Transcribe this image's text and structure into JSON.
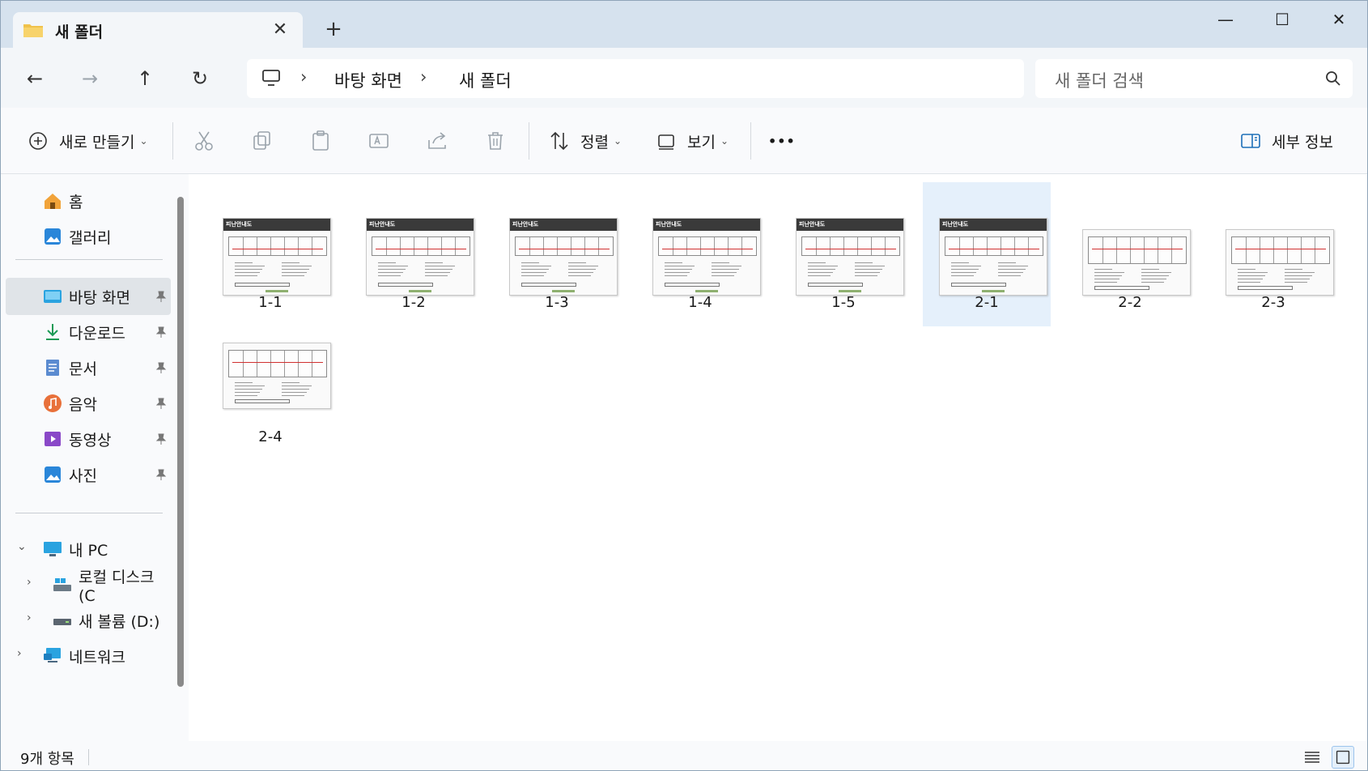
{
  "tab": {
    "title": "새 폴더",
    "close": "✕",
    "add": "+"
  },
  "window_controls": {
    "minimize": "—",
    "maximize": "☐",
    "close": "✕"
  },
  "nav": {
    "back": "←",
    "forward": "→",
    "up": "↑",
    "refresh": "↻"
  },
  "breadcrumb": [
    "바탕 화면",
    "새 폴더"
  ],
  "breadcrumb_separator": "›",
  "search": {
    "placeholder": "새 폴더 검색"
  },
  "commands": {
    "new": "새로 만들기",
    "sort": "정렬",
    "view": "보기",
    "more": "•••",
    "details": "세부 정보"
  },
  "sidebar": {
    "home": "홈",
    "gallery": "갤러리",
    "pinned": [
      {
        "label": "바탕 화면",
        "icon": "desktop-icon"
      },
      {
        "label": "다운로드",
        "icon": "download-icon"
      },
      {
        "label": "문서",
        "icon": "document-icon"
      },
      {
        "label": "음악",
        "icon": "music-icon"
      },
      {
        "label": "동영상",
        "icon": "video-icon"
      },
      {
        "label": "사진",
        "icon": "photo-icon"
      }
    ],
    "this_pc": "내 PC",
    "drives": [
      "로컬 디스크 (C",
      "새 볼륨 (D:)"
    ],
    "network": "네트워크"
  },
  "files": [
    {
      "name": "1-1",
      "selected": false
    },
    {
      "name": "1-2",
      "selected": false
    },
    {
      "name": "1-3",
      "selected": false
    },
    {
      "name": "1-4",
      "selected": false
    },
    {
      "name": "1-5",
      "selected": false
    },
    {
      "name": "2-1",
      "selected": true
    },
    {
      "name": "2-2",
      "selected": false
    },
    {
      "name": "2-3",
      "selected": false
    },
    {
      "name": "2-4",
      "selected": false
    }
  ],
  "thumbnail_header": "피난안내도",
  "status": {
    "item_count": "9개 항목"
  },
  "colors": {
    "accent": "#0067c0",
    "selection": "#e5f0fb",
    "titlebar": "#d6e2ee",
    "folder": "#f0c24b"
  }
}
